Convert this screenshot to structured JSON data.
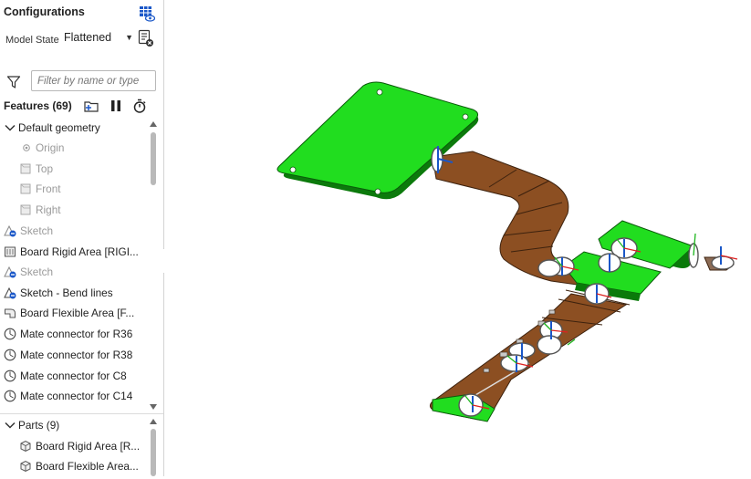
{
  "panel": {
    "title": "Configurations",
    "model_state_label": "Model State",
    "model_state_value": "Flattened",
    "filter_placeholder": "Filter by name or type",
    "features_header": "Features (69)",
    "features": [
      {
        "label": "Default geometry",
        "type": "group-expanded"
      },
      {
        "label": "Origin",
        "type": "origin",
        "dim": true
      },
      {
        "label": "Top",
        "type": "plane",
        "dim": true
      },
      {
        "label": "Front",
        "type": "plane",
        "dim": true
      },
      {
        "label": "Right",
        "type": "plane",
        "dim": true
      },
      {
        "label": "Sketch",
        "type": "sketch",
        "dim": true
      },
      {
        "label": "Board Rigid Area [RIGI...",
        "type": "rigid"
      },
      {
        "label": "Sketch",
        "type": "sketch",
        "dim": true
      },
      {
        "label": "Sketch - Bend lines",
        "type": "sketch"
      },
      {
        "label": "Board Flexible Area [F...",
        "type": "flex"
      },
      {
        "label": "Mate connector for R36",
        "type": "mate"
      },
      {
        "label": "Mate connector for R38",
        "type": "mate"
      },
      {
        "label": "Mate connector for C8",
        "type": "mate"
      },
      {
        "label": "Mate connector for C14",
        "type": "mate"
      }
    ],
    "parts_header": "Parts (9)",
    "parts": [
      {
        "label": "Board Rigid Area [R..."
      },
      {
        "label": "Board Flexible Area..."
      }
    ]
  },
  "icons": {
    "configurations": "grid-eye-icon",
    "model_state": "list-delete-icon",
    "filter": "funnel-icon",
    "new_folder": "folder-plus-icon",
    "pause": "pause-icon",
    "rollback": "stopwatch-icon",
    "toc": "list-indent-icon"
  },
  "colors": {
    "rigid_board": "#21dd1f",
    "flex_board": "#9a5a2a",
    "accent": "#1a57c8"
  }
}
